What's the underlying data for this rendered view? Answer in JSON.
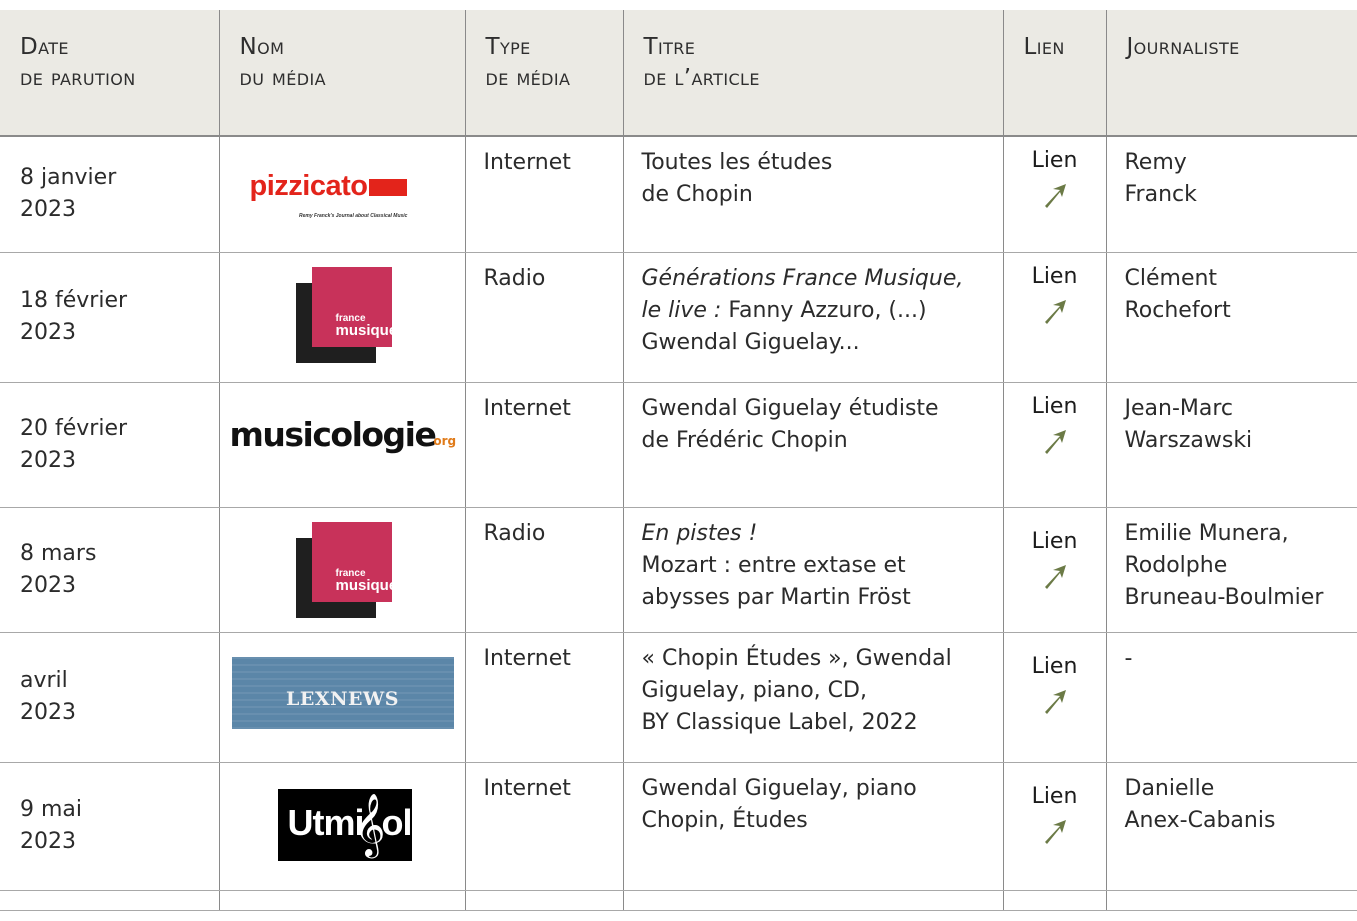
{
  "headers": {
    "date": [
      "Date",
      "de parution"
    ],
    "media": [
      "Nom",
      "du média"
    ],
    "type": [
      "Type",
      "de média"
    ],
    "title": [
      "Titre",
      "de l’article"
    ],
    "link": [
      "Lien"
    ],
    "journalist": [
      "Journaliste"
    ]
  },
  "rows": [
    {
      "date": [
        "8 janvier",
        "2023"
      ],
      "logo": "pizzicato-logo",
      "logo_text": "pizzicato",
      "logo_tagline": "Remy Franck's Journal about Classical Music",
      "type": "Internet",
      "title_lines": [
        {
          "italic": "",
          "text": "Toutes les études"
        },
        {
          "italic": "",
          "text": "de Chopin"
        }
      ],
      "link": "Lien",
      "journalist": [
        "Remy",
        "Franck"
      ]
    },
    {
      "date": [
        "18 février",
        "2023"
      ],
      "logo": "france-musique-logo",
      "logo_text": [
        "france",
        "musique"
      ],
      "type": "Radio",
      "title_lines": [
        {
          "italic": "Générations France Musique,",
          "text": ""
        },
        {
          "italic": "le live :",
          "text": " Fanny Azzuro, (...)"
        },
        {
          "italic": "",
          "text": "Gwendal Giguelay..."
        }
      ],
      "link": "Lien",
      "journalist": [
        "Clément",
        "Rochefort"
      ]
    },
    {
      "date": [
        "20 février",
        "2023"
      ],
      "logo": "musicologie-logo",
      "logo_text": "musicologie",
      "logo_suffix": "org",
      "type": "Internet",
      "title_lines": [
        {
          "italic": "",
          "text": "Gwendal Giguelay étudiste"
        },
        {
          "italic": "",
          "text": "de Frédéric Chopin"
        }
      ],
      "link": "Lien",
      "journalist": [
        "Jean-Marc",
        "Warszawski"
      ]
    },
    {
      "date": [
        "8 mars",
        "2023"
      ],
      "logo": "france-musique-logo",
      "logo_text": [
        "france",
        "musique"
      ],
      "type": "Radio",
      "title_lines": [
        {
          "italic": "En pistes !",
          "text": ""
        },
        {
          "italic": "",
          "text": "Mozart : entre extase et"
        },
        {
          "italic": "",
          "text": "abysses par Martin Fröst"
        }
      ],
      "link": "Lien",
      "journalist": [
        "Emilie Munera,",
        "Rodolphe",
        "Bruneau-Boulmier"
      ]
    },
    {
      "date": [
        "avril",
        "2023"
      ],
      "logo": "lexnews-logo",
      "logo_text": "LEXNEWS",
      "type": "Internet",
      "title_lines": [
        {
          "italic": "",
          "text": "« Chopin Études », Gwendal"
        },
        {
          "italic": "",
          "text": "Giguelay, piano, CD,"
        },
        {
          "italic": "",
          "text": "BY Classique Label, 2022"
        }
      ],
      "link": "Lien",
      "journalist": [
        "-"
      ]
    },
    {
      "date": [
        "9 mai",
        "2023"
      ],
      "logo": "utmisol-logo",
      "logo_text": [
        "Utmi",
        "ol"
      ],
      "type": "Internet",
      "title_lines": [
        {
          "italic": "",
          "text": "Gwendal Giguelay, piano"
        },
        {
          "italic": "",
          "text": "Chopin, Études"
        }
      ],
      "link": "Lien",
      "journalist": [
        "Danielle",
        "Anex-Cabanis"
      ]
    }
  ],
  "colors": {
    "header_bg": "#ebeae4",
    "arrow": "#6b7a46",
    "pizzicato_red": "#e3241b",
    "france_musique_red": "#c8325a",
    "lexnews_blue": "#5b86a8"
  }
}
